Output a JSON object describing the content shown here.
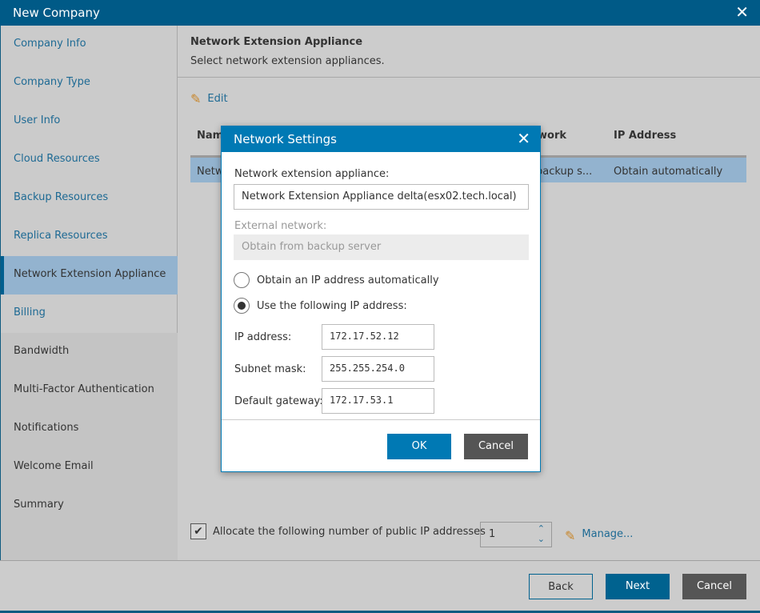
{
  "window": {
    "title": "New Company",
    "close_icon": "close-icon"
  },
  "sidebar": {
    "items": [
      {
        "label": "Company Info"
      },
      {
        "label": "Company Type"
      },
      {
        "label": "User Info"
      },
      {
        "label": "Cloud Resources"
      },
      {
        "label": "Backup Resources"
      },
      {
        "label": "Replica Resources"
      },
      {
        "label": "Network Extension Appliance"
      },
      {
        "label": "Billing"
      },
      {
        "label": "Bandwidth"
      },
      {
        "label": "Multi-Factor Authentication"
      },
      {
        "label": "Notifications"
      },
      {
        "label": "Welcome Email"
      },
      {
        "label": "Summary"
      }
    ],
    "active_index": 6
  },
  "content": {
    "title": "Network Extension Appliance",
    "subtitle": "Select network extension appliances.",
    "edit_label": "Edit",
    "table": {
      "columns": [
        "Nam",
        "work",
        "IP Address"
      ],
      "row": [
        "Netw",
        "backup s...",
        "Obtain automatically"
      ]
    },
    "allocate_label": "Allocate the following number of public IP addresses",
    "allocate_checked": true,
    "allocate_count": "1",
    "manage_label": "Manage..."
  },
  "footer": {
    "back": "Back",
    "next": "Next",
    "cancel": "Cancel"
  },
  "modal": {
    "title": "Network Settings",
    "appliance_label": "Network extension appliance:",
    "appliance_value": "Network Extension Appliance delta(esx02.tech.local)",
    "external_label": "External network:",
    "external_value": "Obtain from backup server",
    "radio_auto": "Obtain an IP address automatically",
    "radio_manual": "Use the following IP address:",
    "ip_label": "IP address:",
    "ip_value": "172.17.52.12",
    "mask_label": "Subnet mask:",
    "mask_value": "255.255.254.0",
    "gw_label": "Default gateway:",
    "gw_value": "172.17.53.1",
    "ok": "OK",
    "cancel": "Cancel"
  },
  "colors": {
    "titlebar": "#005a87",
    "modal_header": "#0079b4",
    "selected": "#93b3cf",
    "primary_button": "#00628f",
    "dark_button": "#555555"
  }
}
